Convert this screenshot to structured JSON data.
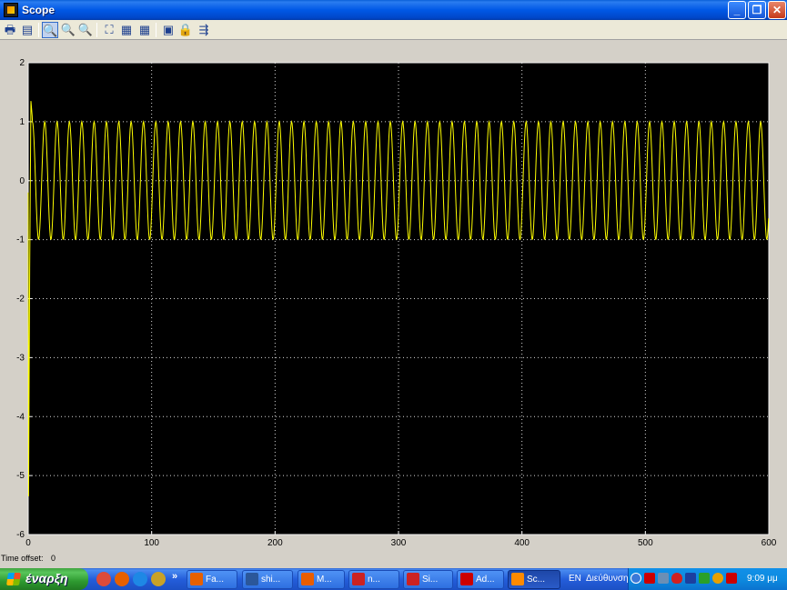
{
  "window": {
    "title": "Scope",
    "minimize": "_",
    "maximize": "❐",
    "close": "✕"
  },
  "toolbar": {
    "buttons": [
      {
        "name": "print-icon",
        "glyph": "🖶"
      },
      {
        "name": "parameters-icon",
        "glyph": "▤"
      },
      {
        "name": "zoom-icon",
        "glyph": "🔍"
      },
      {
        "name": "zoom-x-icon",
        "glyph": "🔍"
      },
      {
        "name": "zoom-y-icon",
        "glyph": "🔍"
      },
      {
        "name": "autoscale-icon",
        "glyph": "⛶"
      },
      {
        "name": "save-axes-icon",
        "glyph": "▦"
      },
      {
        "name": "restore-axes-icon",
        "glyph": "▦"
      },
      {
        "name": "floating-scope-icon",
        "glyph": "▣"
      },
      {
        "name": "lock-axes-icon",
        "glyph": "🔒"
      },
      {
        "name": "signal-selection-icon",
        "glyph": "⇶"
      }
    ]
  },
  "status": {
    "time_offset_label": "Time offset:",
    "time_offset_value": "0"
  },
  "chart_data": {
    "type": "line",
    "title": "",
    "xlabel": "",
    "ylabel": "",
    "xlim": [
      0,
      600
    ],
    "ylim": [
      -6,
      2
    ],
    "xticks": [
      "0",
      "100",
      "200",
      "300",
      "400",
      "500",
      "600"
    ],
    "yticks": [
      "2",
      "1",
      "0",
      "-1",
      "-2",
      "-3",
      "-4",
      "-5",
      "-6"
    ],
    "grid": true,
    "background": "#000000",
    "line_color": "#ffff00",
    "series": [
      {
        "description_signal": "sinusoid",
        "amplitude": 1,
        "cycles_over_range": 60,
        "initial_transient": {
          "min": -5.35,
          "peak": 1.35
        },
        "x_start": 0,
        "x_end": 600
      }
    ]
  },
  "taskbar": {
    "start_label": "έναρξη",
    "quick_launch": [
      {
        "name": "chrome-icon",
        "color": "#dd4b39"
      },
      {
        "name": "firefox-icon",
        "color": "#e66000"
      },
      {
        "name": "ie-icon",
        "color": "#1e88e5"
      },
      {
        "name": "quicklaunch-more-icon",
        "color": "#c9a227"
      }
    ],
    "chevron": "»",
    "tasks": [
      {
        "label": "Fa...",
        "color": "#e66000"
      },
      {
        "label": "shi...",
        "color": "#2b579a"
      },
      {
        "label": "M...",
        "color": "#e85d00"
      },
      {
        "label": "n...",
        "color": "#cc2222"
      },
      {
        "label": "Si...",
        "color": "#cc2222"
      },
      {
        "label": "Ad...",
        "color": "#cc0000"
      },
      {
        "label": "Sc...",
        "color": "#ff8a00"
      }
    ],
    "language": "EN",
    "address_label": "Διεύθυνση",
    "clock": "9:09 μμ"
  }
}
